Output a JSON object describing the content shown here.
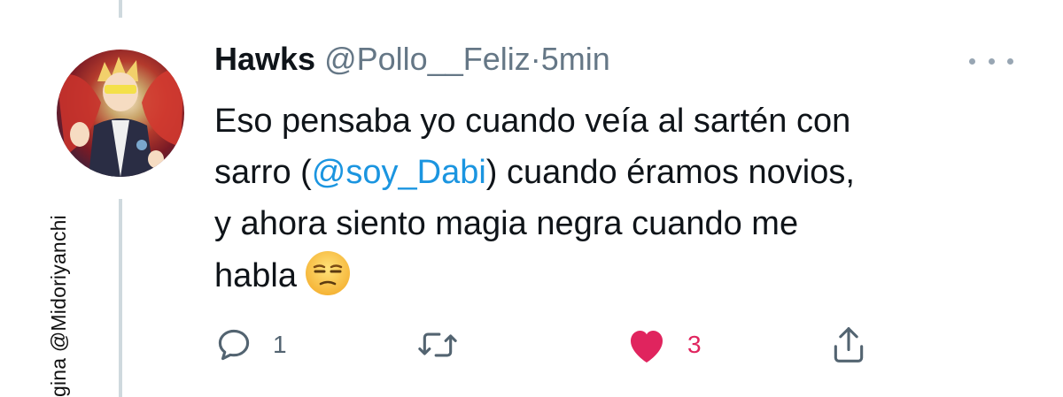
{
  "watermark": "gina @Midoriyanchi",
  "tweet": {
    "author_name": "Hawks",
    "author_handle": "@Pollo__Feliz",
    "separator": "·",
    "time": "5min",
    "body": {
      "line1": "Eso pensaba yo cuando veía al sartén con",
      "line2_before": "sarro (",
      "line2_mention": "@soy_Dabi",
      "line2_after": ") cuando éramos novios,",
      "line3": "y ahora siento magia negra cuando me",
      "line4": "habla"
    },
    "emoji_icon": "unamused-face-icon",
    "actions": {
      "reply_count": "1",
      "retweet_count": "",
      "like_count": "3",
      "liked": true
    }
  },
  "colors": {
    "text": "#0f1419",
    "secondary": "#657786",
    "mention": "#1b95e0",
    "like": "#e0245e",
    "thread_line": "#cfd9de"
  }
}
